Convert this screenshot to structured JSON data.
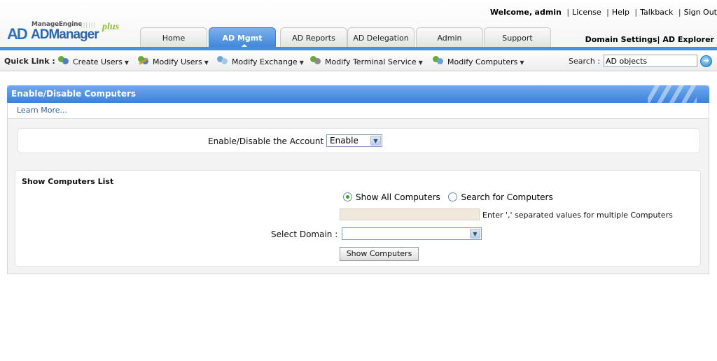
{
  "brand": {
    "vendor": "ManageEngine",
    "product_ad": "AD",
    "product_name": "Manager",
    "product_suffix": "plus"
  },
  "top_links": {
    "welcome": "Welcome,",
    "user": "admin",
    "license": "License",
    "help": "Help",
    "talkback": "Talkback",
    "sign_out": "Sign Out"
  },
  "domain_links": {
    "domain_settings": "Domain Settings",
    "ad_explorer": "AD Explorer"
  },
  "tabs": [
    {
      "label": "Home",
      "active": false
    },
    {
      "label": "AD Mgmt",
      "active": true
    },
    {
      "label": "AD Reports",
      "active": false
    },
    {
      "label": "AD Delegation",
      "active": false
    },
    {
      "label": "Admin",
      "active": false
    },
    {
      "label": "Support",
      "active": false
    }
  ],
  "quick_links": {
    "label": "Quick Link :",
    "items": [
      {
        "label": "Create Users",
        "icon": "create-users-icon"
      },
      {
        "label": "Modify Users",
        "icon": "modify-users-icon"
      },
      {
        "label": "Modify Exchange",
        "icon": "exchange-icon"
      },
      {
        "label": "Modify Terminal Service",
        "icon": "terminal-service-icon"
      },
      {
        "label": "Modify Computers",
        "icon": "computers-icon"
      }
    ]
  },
  "search": {
    "label": "Search :",
    "value": "AD objects",
    "go_icon": "arrow-right-icon"
  },
  "panel": {
    "title": "Enable/Disable Computers",
    "learn_more": "Learn More...",
    "account": {
      "label": "Enable/Disable the Account :",
      "selected": "Enable"
    },
    "computers": {
      "title": "Show Computers List",
      "radio_all": "Show All Computers",
      "radio_search": "Search for Computers",
      "selected_radio": "all",
      "input_value": "",
      "hint": "Enter ',' separated values for multiple Computers",
      "domain_label": "Select Domain :",
      "domain_selected": "",
      "button": "Show Computers"
    }
  },
  "colors": {
    "accent_blue": "#3f86dc",
    "panel_header": "#3b82d8",
    "radio_checked": "#35a02b"
  }
}
